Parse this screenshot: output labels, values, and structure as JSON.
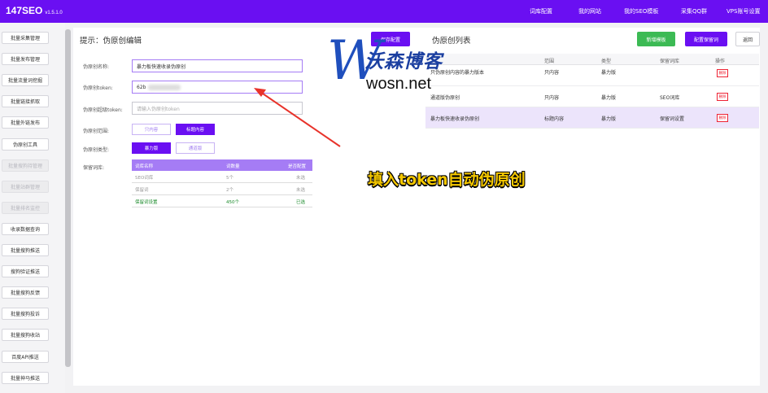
{
  "header": {
    "logo": "147SEO",
    "version": "v1.5.1.0",
    "nav": [
      "词库配置",
      "我的网站",
      "我的SEO模板",
      "采集QQ群",
      "VPS账号设置"
    ]
  },
  "sidebar": {
    "items": [
      {
        "label": "批量采集管理",
        "disabled": false
      },
      {
        "label": "批量发布管理",
        "disabled": false
      },
      {
        "label": "批量流量词挖掘",
        "disabled": false
      },
      {
        "label": "批量链接抓取",
        "disabled": false
      },
      {
        "label": "批量外链发布",
        "disabled": false
      },
      {
        "label": "伪原创工具",
        "disabled": false
      },
      {
        "label": "批量搜狗持管理",
        "disabled": true
      },
      {
        "label": "批量站群管理",
        "disabled": true
      },
      {
        "label": "批量排名监控",
        "disabled": true
      },
      {
        "label": "收录数据查询",
        "disabled": false
      },
      {
        "label": "批量搜狗推送",
        "disabled": false
      },
      {
        "label": "搜狗验证推送",
        "disabled": false
      },
      {
        "label": "批量搜狗反馈",
        "disabled": false
      },
      {
        "label": "批量搜狗投诉",
        "disabled": false
      },
      {
        "label": "批量搜狗收站",
        "disabled": false
      },
      {
        "label": "百度API推送",
        "disabled": false
      },
      {
        "label": "批量神马推送",
        "disabled": false
      }
    ]
  },
  "editor": {
    "title": "提示：伪原创编辑",
    "save_button": "保存配置",
    "name_label": "伪原创名称:",
    "name_value": "暴力板快速收录伪原创",
    "token_label": "伪原创token:",
    "token_value": "62b",
    "backup_token_label": "伪原创超级token:",
    "backup_token_placeholder": "请输入伪原创token",
    "scope_label": "伪原创范围:",
    "scope_options": [
      "只内容",
      "标题内容"
    ],
    "scope_selected": 1,
    "type_label": "伪原创类型:",
    "type_options": [
      "暴力版",
      "通道版"
    ],
    "type_selected": 0,
    "keep_label": "保留词库:",
    "keep_table": {
      "headers": [
        "词库名称",
        "词数量",
        "是否配置"
      ],
      "rows": [
        {
          "name": "SEO词库",
          "count": "5个",
          "status": "未选",
          "active": false
        },
        {
          "name": "保留词",
          "count": "2个",
          "status": "未选",
          "active": false
        },
        {
          "name": "保留词设置",
          "count": "450个",
          "status": "已选",
          "active": true
        }
      ]
    }
  },
  "list": {
    "title": "伪原创列表",
    "add_button": "新增模板",
    "config_button": "配置保留词",
    "back_button": "返回",
    "headers": [
      "范围",
      "类型",
      "保留词库",
      "操作"
    ],
    "rows": [
      {
        "name": "只伪原创内容的暴力版本",
        "scope": "只内容",
        "type": "暴力版",
        "keep": "",
        "action": "删除",
        "highlight": false
      },
      {
        "name": "通道版伪原创",
        "scope": "只内容",
        "type": "暴力版",
        "keep": "SEO词库",
        "action": "删除",
        "highlight": false
      },
      {
        "name": "暴力板快速收录伪原创",
        "scope": "标题内容",
        "type": "暴力版",
        "keep": "保留词设置",
        "action": "删除",
        "highlight": true
      }
    ]
  },
  "watermark": {
    "letter": "W",
    "brand": "沃森博客",
    "url": "wosn.net"
  },
  "caption": "填入token自动伪原创",
  "colors": {
    "accent": "#6a0ff2",
    "green": "#3cba54",
    "delete_red": "#e22233",
    "caption_yellow": "#f5c800"
  }
}
